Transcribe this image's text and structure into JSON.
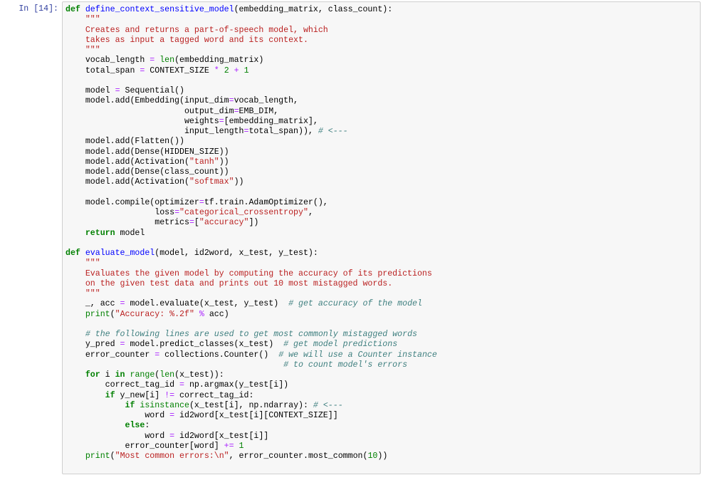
{
  "notebook": {
    "prompt": "In [14]:",
    "cell_type": "code",
    "language": "python",
    "colors": {
      "prompt": "#303f9f",
      "keyword": "#008000",
      "function_name": "#0000ff",
      "string": "#ba2121",
      "operator": "#aa22ff",
      "number": "#008000",
      "comment": "#408080",
      "cell_background": "#f7f7f7",
      "cell_border": "#cfcfcf"
    },
    "lines": [
      [
        [
          "kw",
          "def"
        ],
        [
          "tx",
          " "
        ],
        [
          "fn",
          "define_context_sensitive_model"
        ],
        [
          "tx",
          "(embedding_matrix, class_count):"
        ]
      ],
      [
        [
          "st",
          "    \"\"\""
        ]
      ],
      [
        [
          "st",
          "    Creates and returns a part-of-speech model, which"
        ]
      ],
      [
        [
          "st",
          "    takes as input a tagged word and its context."
        ]
      ],
      [
        [
          "st",
          "    \"\"\""
        ]
      ],
      [
        [
          "tx",
          "    vocab_length "
        ],
        [
          "op",
          "="
        ],
        [
          "tx",
          " "
        ],
        [
          "bi",
          "len"
        ],
        [
          "tx",
          "(embedding_matrix)"
        ]
      ],
      [
        [
          "tx",
          "    total_span "
        ],
        [
          "op",
          "="
        ],
        [
          "tx",
          " CONTEXT_SIZE "
        ],
        [
          "op",
          "*"
        ],
        [
          "tx",
          " "
        ],
        [
          "nu",
          "2"
        ],
        [
          "tx",
          " "
        ],
        [
          "op",
          "+"
        ],
        [
          "tx",
          " "
        ],
        [
          "nu",
          "1"
        ]
      ],
      [
        [
          "tx",
          ""
        ]
      ],
      [
        [
          "tx",
          "    model "
        ],
        [
          "op",
          "="
        ],
        [
          "tx",
          " Sequential()"
        ]
      ],
      [
        [
          "tx",
          "    model.add(Embedding(input_dim"
        ],
        [
          "op",
          "="
        ],
        [
          "tx",
          "vocab_length,"
        ]
      ],
      [
        [
          "tx",
          "                        output_dim"
        ],
        [
          "op",
          "="
        ],
        [
          "tx",
          "EMB_DIM,"
        ]
      ],
      [
        [
          "tx",
          "                        weights"
        ],
        [
          "op",
          "="
        ],
        [
          "tx",
          "[embedding_matrix],"
        ]
      ],
      [
        [
          "tx",
          "                        input_length"
        ],
        [
          "op",
          "="
        ],
        [
          "tx",
          "total_span)), "
        ],
        [
          "cm",
          "# <---"
        ]
      ],
      [
        [
          "tx",
          "    model.add(Flatten())"
        ]
      ],
      [
        [
          "tx",
          "    model.add(Dense(HIDDEN_SIZE))"
        ]
      ],
      [
        [
          "tx",
          "    model.add(Activation("
        ],
        [
          "st",
          "\"tanh\""
        ],
        [
          "tx",
          "))"
        ]
      ],
      [
        [
          "tx",
          "    model.add(Dense(class_count))"
        ]
      ],
      [
        [
          "tx",
          "    model.add(Activation("
        ],
        [
          "st",
          "\"softmax\""
        ],
        [
          "tx",
          "))"
        ]
      ],
      [
        [
          "tx",
          ""
        ]
      ],
      [
        [
          "tx",
          "    model.compile(optimizer"
        ],
        [
          "op",
          "="
        ],
        [
          "tx",
          "tf.train.AdamOptimizer(),"
        ]
      ],
      [
        [
          "tx",
          "                  loss"
        ],
        [
          "op",
          "="
        ],
        [
          "st",
          "\"categorical_crossentropy\""
        ],
        [
          "tx",
          ","
        ]
      ],
      [
        [
          "tx",
          "                  metrics"
        ],
        [
          "op",
          "="
        ],
        [
          "tx",
          "["
        ],
        [
          "st",
          "\"accuracy\""
        ],
        [
          "tx",
          "])"
        ]
      ],
      [
        [
          "tx",
          "    "
        ],
        [
          "kw",
          "return"
        ],
        [
          "tx",
          " model"
        ]
      ],
      [
        [
          "tx",
          ""
        ]
      ],
      [
        [
          "kw",
          "def"
        ],
        [
          "tx",
          " "
        ],
        [
          "fn",
          "evaluate_model"
        ],
        [
          "tx",
          "(model, id2word, x_test, y_test):"
        ]
      ],
      [
        [
          "st",
          "    \"\"\""
        ]
      ],
      [
        [
          "st",
          "    Evaluates the given model by computing the accuracy of its predictions"
        ]
      ],
      [
        [
          "st",
          "    on the given test data and prints out 10 most mistagged words."
        ]
      ],
      [
        [
          "st",
          "    \"\"\""
        ]
      ],
      [
        [
          "tx",
          "    _, acc "
        ],
        [
          "op",
          "="
        ],
        [
          "tx",
          " model.evaluate(x_test, y_test)  "
        ],
        [
          "cm",
          "# get accuracy of the model"
        ]
      ],
      [
        [
          "tx",
          "    "
        ],
        [
          "bi",
          "print"
        ],
        [
          "tx",
          "("
        ],
        [
          "st",
          "\"Accuracy: %.2f\""
        ],
        [
          "tx",
          " "
        ],
        [
          "op",
          "%"
        ],
        [
          "tx",
          " acc)"
        ]
      ],
      [
        [
          "tx",
          ""
        ]
      ],
      [
        [
          "tx",
          "    "
        ],
        [
          "cm",
          "# the following lines are used to get most commonly mistagged words"
        ]
      ],
      [
        [
          "tx",
          "    y_pred "
        ],
        [
          "op",
          "="
        ],
        [
          "tx",
          " model.predict_classes(x_test)  "
        ],
        [
          "cm",
          "# get model predictions"
        ]
      ],
      [
        [
          "tx",
          "    error_counter "
        ],
        [
          "op",
          "="
        ],
        [
          "tx",
          " collections.Counter()  "
        ],
        [
          "cm",
          "# we will use a Counter instance"
        ]
      ],
      [
        [
          "tx",
          "                                            "
        ],
        [
          "cm",
          "# to count model's errors"
        ]
      ],
      [
        [
          "tx",
          "    "
        ],
        [
          "kw",
          "for"
        ],
        [
          "tx",
          " i "
        ],
        [
          "kw",
          "in"
        ],
        [
          "tx",
          " "
        ],
        [
          "bi",
          "range"
        ],
        [
          "tx",
          "("
        ],
        [
          "bi",
          "len"
        ],
        [
          "tx",
          "(x_test)):"
        ]
      ],
      [
        [
          "tx",
          "        correct_tag_id "
        ],
        [
          "op",
          "="
        ],
        [
          "tx",
          " np.argmax(y_test[i])"
        ]
      ],
      [
        [
          "tx",
          "        "
        ],
        [
          "kw",
          "if"
        ],
        [
          "tx",
          " y_new[i] "
        ],
        [
          "op",
          "!="
        ],
        [
          "tx",
          " correct_tag_id:"
        ]
      ],
      [
        [
          "tx",
          "            "
        ],
        [
          "kw",
          "if"
        ],
        [
          "tx",
          " "
        ],
        [
          "bi",
          "isinstance"
        ],
        [
          "tx",
          "(x_test[i], np.ndarray): "
        ],
        [
          "cm",
          "# <---"
        ]
      ],
      [
        [
          "tx",
          "                word "
        ],
        [
          "op",
          "="
        ],
        [
          "tx",
          " id2word[x_test[i][CONTEXT_SIZE]]"
        ]
      ],
      [
        [
          "tx",
          "            "
        ],
        [
          "kw",
          "else"
        ],
        [
          "tx",
          ":"
        ]
      ],
      [
        [
          "tx",
          "                word "
        ],
        [
          "op",
          "="
        ],
        [
          "tx",
          " id2word[x_test[i]]"
        ]
      ],
      [
        [
          "tx",
          "            error_counter[word] "
        ],
        [
          "op",
          "+="
        ],
        [
          "tx",
          " "
        ],
        [
          "nu",
          "1"
        ]
      ],
      [
        [
          "tx",
          "    "
        ],
        [
          "bi",
          "print"
        ],
        [
          "tx",
          "("
        ],
        [
          "st",
          "\"Most common errors:\\n\""
        ],
        [
          "tx",
          ", error_counter.most_common("
        ],
        [
          "nu",
          "10"
        ],
        [
          "tx",
          "))"
        ]
      ]
    ]
  }
}
